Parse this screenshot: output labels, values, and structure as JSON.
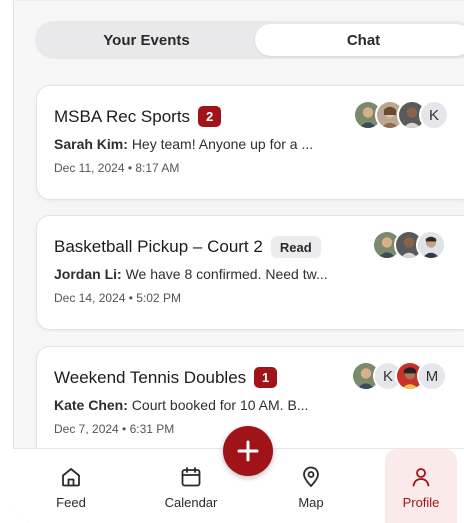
{
  "tabs": [
    {
      "label": "Your Events",
      "active": false
    },
    {
      "label": "Chat",
      "active": true
    }
  ],
  "chats": [
    {
      "title": "MSBA Rec Sports",
      "badge": "2",
      "badge_type": "unread",
      "sender": "Sarah Kim:",
      "message": "Hey team! Anyone up for a ...",
      "time": "Dec 11, 2024 • 8:17 AM",
      "avatars": [
        "photo",
        "photo",
        "photo",
        "K"
      ]
    },
    {
      "title": "Basketball Pickup – Court 2",
      "badge": "Read",
      "badge_type": "read",
      "sender": "Jordan Li:",
      "message": "We have 8 confirmed. Need tw...",
      "time": "Dec 14, 2024 • 5:02 PM",
      "avatars": [
        "photo",
        "photo",
        "photo"
      ]
    },
    {
      "title": "Weekend Tennis Doubles",
      "badge": "1",
      "badge_type": "unread",
      "sender": "Kate Chen:",
      "message": "Court booked for 10 AM. B...",
      "time": "Dec 7, 2024 • 6:31 PM",
      "avatars": [
        "photo",
        "K",
        "photo",
        "M"
      ]
    }
  ],
  "nav": [
    {
      "label": "Feed",
      "icon": "home-icon",
      "active": false
    },
    {
      "label": "Calendar",
      "icon": "calendar-icon",
      "active": false
    },
    {
      "label": "Map",
      "icon": "map-pin-icon",
      "active": false
    },
    {
      "label": "Profile",
      "icon": "user-icon",
      "active": true
    }
  ],
  "fab_icon": "plus-icon",
  "colors": {
    "accent": "#a01419",
    "active_nav_bg": "#fbeaea",
    "badge_read_bg": "#ececee"
  }
}
